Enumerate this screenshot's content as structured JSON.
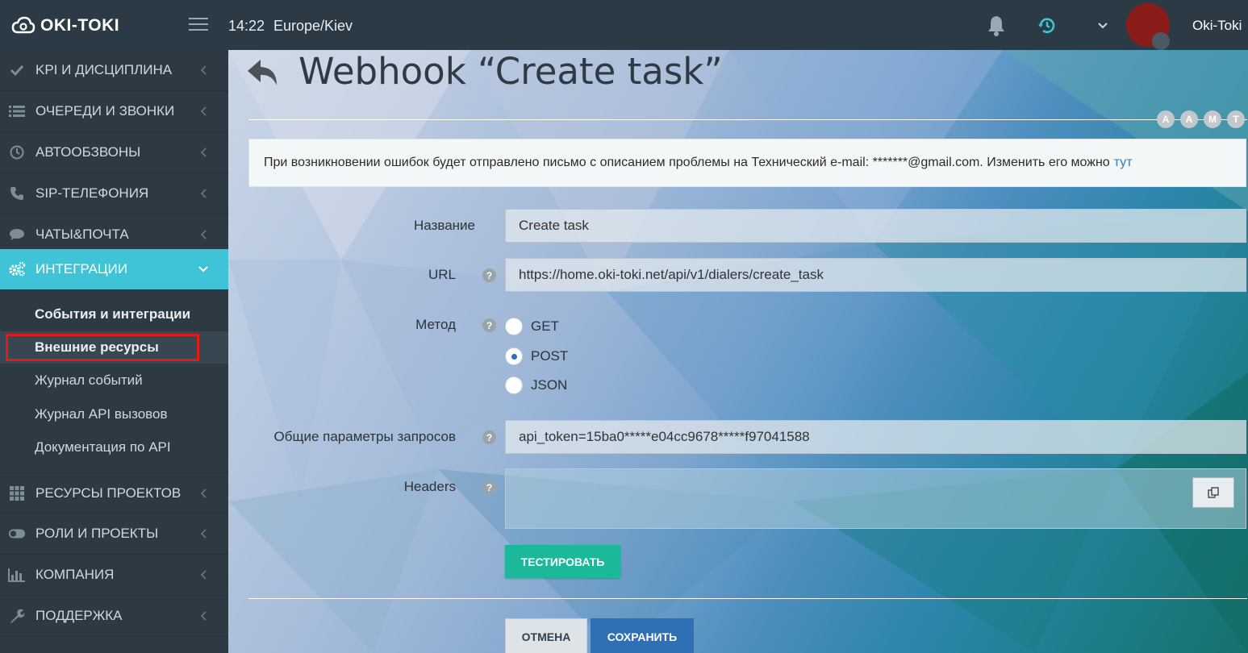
{
  "header": {
    "logo_text": "OKI-TOKI",
    "time": "14:22",
    "timezone": "Europe/Kiev",
    "username": "Oki-Toki"
  },
  "sidebar": {
    "items": [
      {
        "label": "KPI И ДИСЦИПЛИНА",
        "icon": "check-icon"
      },
      {
        "label": "ОЧЕРЕДИ И ЗВОНКИ",
        "icon": "list-icon"
      },
      {
        "label": "АВТООБЗВОНЫ",
        "icon": "clock-icon"
      },
      {
        "label": "SIP-ТЕЛЕФОНИЯ",
        "icon": "phone-icon"
      },
      {
        "label": "ЧАТЫ&ПОЧТА",
        "icon": "chat-icon"
      },
      {
        "label": "ИНТЕГРАЦИИ",
        "icon": "gears-icon"
      },
      {
        "label": "РЕСУРСЫ ПРОЕКТОВ",
        "icon": "grid-icon"
      },
      {
        "label": "РОЛИ И ПРОЕКТЫ",
        "icon": "toggle-icon"
      },
      {
        "label": "КОМПАНИЯ",
        "icon": "bar-chart-icon"
      },
      {
        "label": "ПОДДЕРЖКА",
        "icon": "wrench-icon"
      }
    ],
    "submenu": [
      {
        "label": "События и интеграции"
      },
      {
        "label": "Внешние ресурсы"
      },
      {
        "label": "Журнал событий"
      },
      {
        "label": "Журнал API вызовов"
      },
      {
        "label": "Документация по API"
      }
    ]
  },
  "main": {
    "title": "Webhook “Create task”",
    "font_buttons": [
      "A",
      "A",
      "M",
      "T"
    ],
    "alert_text": "При возникновении ошибок будет отправлено письмо с описанием проблемы на Технический e-mail: *******@gmail.com. Изменить его можно",
    "alert_link": "тут",
    "form": {
      "name_label": "Название",
      "name_value": "Create task",
      "url_label": "URL",
      "url_value": "https://home.oki-toki.net/api/v1/dialers/create_task",
      "method_label": "Метод",
      "methods": [
        "GET",
        "POST",
        "JSON"
      ],
      "method_selected": "POST",
      "params_label": "Общие параметры запросов",
      "params_value": "api_token=15ba0*****e04cc9678*****f97041588",
      "headers_label": "Headers",
      "headers_value": ""
    },
    "buttons": {
      "test": "ТЕСТИРОВАТЬ",
      "cancel": "ОТМЕНА",
      "save": "СОХРАНИТЬ"
    }
  },
  "colors": {
    "accent": "#3ec3d7",
    "save": "#2f6fb4",
    "test": "#1bb99a",
    "highlight": "#e01b1b"
  }
}
